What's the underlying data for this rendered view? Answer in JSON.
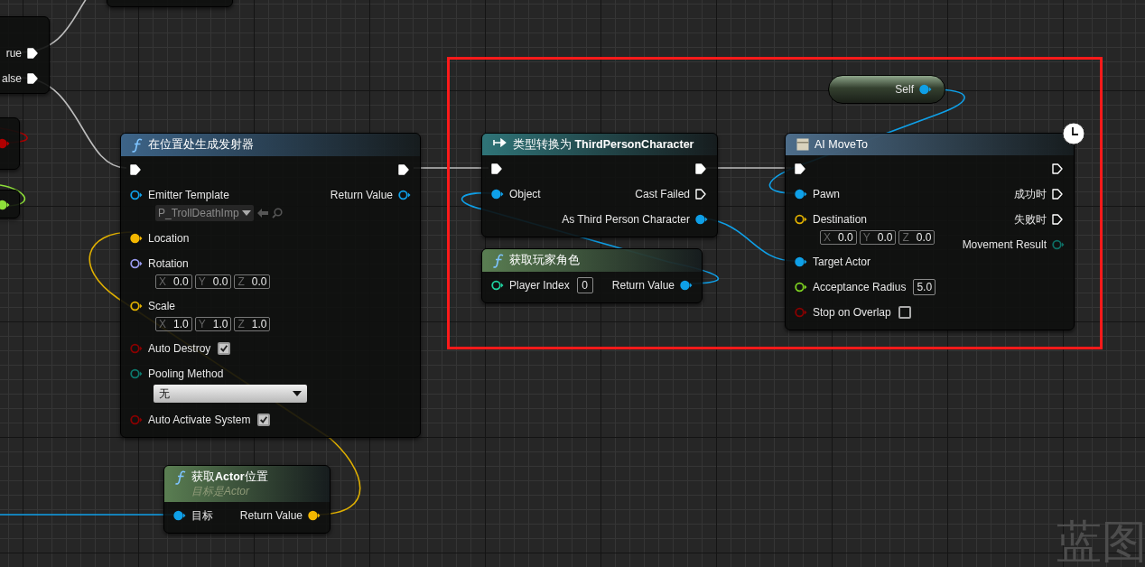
{
  "graph_label": "蓝图",
  "nodes": [
    {
      "kind": "partial",
      "outputs": [
        {
          "kind": "exec",
          "label": "rue",
          "linked": true
        },
        {
          "kind": "exec",
          "label": "alse",
          "linked": true
        }
      ]
    },
    {
      "kind": "partial"
    },
    {
      "kind": "partial",
      "outputs": [
        {
          "kind": "data",
          "color": "#b00000",
          "linked": true
        }
      ]
    },
    {
      "kind": "partial",
      "outputs": [
        {
          "kind": "data",
          "color": "#8ee03a",
          "linked": true
        }
      ]
    },
    {
      "kind": "function",
      "color": "#3d6488",
      "title": "在位置处生成发射器",
      "inputs": [
        {
          "kind": "exec",
          "linked": true
        },
        {
          "kind": "data",
          "label": "Emitter Template",
          "color": "#0fa0e8",
          "linked": false,
          "value": {
            "kind": "asset",
            "text": "P_TrollDeathImp"
          }
        },
        {
          "kind": "data",
          "label": "Location",
          "color": "#f5b800",
          "linked": true
        },
        {
          "kind": "data",
          "label": "Rotation",
          "color": "#9a9cf0",
          "linked": false,
          "value": {
            "kind": "vector",
            "fields": [
              {
                "axis": "X",
                "value": "0.0"
              },
              {
                "axis": "Y",
                "value": "0.0"
              },
              {
                "axis": "Z",
                "value": "0.0"
              }
            ]
          }
        },
        {
          "kind": "data",
          "label": "Scale",
          "color": "#e0b000",
          "linked": false,
          "value": {
            "kind": "vector",
            "fields": [
              {
                "axis": "X",
                "value": "1.0"
              },
              {
                "axis": "Y",
                "value": "1.0"
              },
              {
                "axis": "Z",
                "value": "1.0"
              }
            ]
          }
        },
        {
          "kind": "data",
          "label": "Auto Destroy",
          "color": "#8a0000",
          "linked": false,
          "value": {
            "kind": "checkbox",
            "checked": true
          }
        },
        {
          "kind": "data",
          "label": "Pooling Method",
          "color": "#0d7a6e",
          "linked": false,
          "value": {
            "kind": "dropdown",
            "text": "无"
          }
        },
        {
          "kind": "data",
          "label": "Auto Activate System",
          "color": "#8a0000",
          "linked": false,
          "value": {
            "kind": "checkbox",
            "checked": true
          }
        }
      ],
      "outputs": [
        {
          "kind": "exec",
          "linked": true
        },
        {
          "kind": "data",
          "label": "Return Value",
          "color": "#0fa0e8",
          "linked": false
        }
      ]
    },
    {
      "kind": "cast",
      "color": "#2f7478",
      "title": "类型转换为 **ThirdPersonCharacter**",
      "inputs": [
        {
          "kind": "exec",
          "linked": true
        },
        {
          "kind": "data",
          "label": "Object",
          "color": "#0fa0e8",
          "linked": true
        }
      ],
      "outputs": [
        {
          "kind": "exec",
          "linked": true
        },
        {
          "kind": "exec",
          "label": "Cast Failed",
          "linked": false
        },
        {
          "kind": "data",
          "label": "As Third Person Character",
          "color": "#0fa0e8",
          "linked": true
        }
      ]
    },
    {
      "kind": "function",
      "color": "#5a7e52",
      "title": "获取玩家角色",
      "inputs": [
        {
          "kind": "data",
          "label": "Player Index",
          "color": "#1fd3a0",
          "linked": false,
          "value": {
            "kind": "number",
            "text": "0"
          }
        }
      ],
      "outputs": [
        {
          "kind": "data",
          "label": "Return Value",
          "color": "#0fa0e8",
          "linked": true
        }
      ]
    },
    {
      "kind": "variable",
      "outputs": [
        {
          "kind": "data",
          "label": "Self",
          "color": "#0fa0e8",
          "linked": true
        }
      ]
    },
    {
      "kind": "latent",
      "color": "#4d6d8a",
      "title": "AI MoveTo",
      "latent": true,
      "inputs": [
        {
          "kind": "exec",
          "linked": true
        },
        {
          "kind": "data",
          "label": "Pawn",
          "color": "#0fa0e8",
          "linked": true
        },
        {
          "kind": "data",
          "label": "Destination",
          "color": "#e0b000",
          "linked": false,
          "value": {
            "kind": "vector",
            "fields": [
              {
                "axis": "X",
                "value": "0.0"
              },
              {
                "axis": "Y",
                "value": "0.0"
              },
              {
                "axis": "Z",
                "value": "0.0"
              }
            ]
          }
        },
        {
          "kind": "data",
          "label": "Target Actor",
          "color": "#0fa0e8",
          "linked": true
        },
        {
          "kind": "data",
          "label": "Acceptance Radius",
          "color": "#7ed321",
          "linked": false,
          "value": {
            "kind": "number",
            "text": "5.0"
          }
        },
        {
          "kind": "data",
          "label": "Stop on Overlap",
          "color": "#8a0000",
          "linked": false,
          "value": {
            "kind": "checkbox",
            "checked": false
          }
        }
      ],
      "outputs": [
        {
          "kind": "exec",
          "linked": false
        },
        {
          "kind": "exec",
          "label": "成功时",
          "linked": false
        },
        {
          "kind": "exec",
          "label": "失败时",
          "linked": false
        },
        {
          "kind": "data",
          "label": "Movement Result",
          "color": "#0d6e64",
          "linked": false
        }
      ]
    },
    {
      "kind": "function",
      "color": "#5a7e52",
      "title": "获取**Actor**位置",
      "subtitle": "目标是Actor",
      "inputs": [
        {
          "kind": "data",
          "label": "目标",
          "color": "#0fa0e8",
          "linked": true
        }
      ],
      "outputs": [
        {
          "kind": "data",
          "label": "Return Value",
          "color": "#f5b800",
          "linked": true
        }
      ]
    }
  ]
}
